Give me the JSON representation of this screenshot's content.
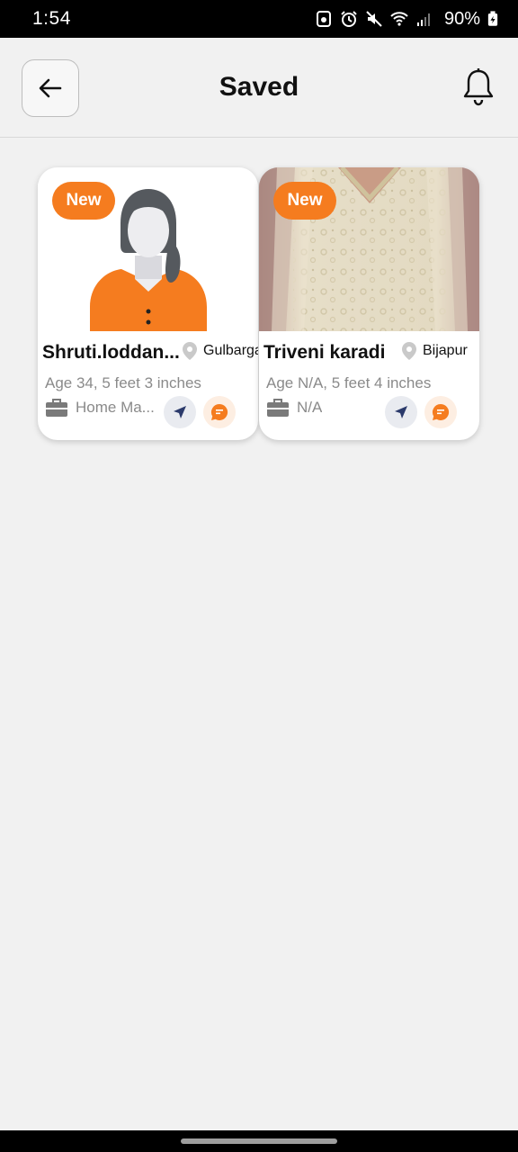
{
  "status_bar": {
    "time": "1:54",
    "battery": "90%",
    "icons": [
      "app-notification-icon",
      "alarm-icon",
      "mute-icon",
      "wifi-icon",
      "signal-icon",
      "battery-charging-icon"
    ]
  },
  "header": {
    "title": "Saved",
    "back_icon": "arrow-left-icon",
    "notification_icon": "bell-icon"
  },
  "profiles": [
    {
      "badge": "New",
      "name": "Shruti.loddan...",
      "location": "Gulbarga",
      "age_height": "Age 34, 5 feet 3 inches",
      "occupation": "Home Ma...",
      "photo": "placeholder-avatar-female"
    },
    {
      "badge": "New",
      "name": "Triveni karadi",
      "location": "Bijapur",
      "age_height": "Age N/A, 5 feet 4 inches",
      "occupation": "N/A",
      "photo": "photo-cream-embroidered-dress"
    }
  ],
  "colors": {
    "accent": "#f57c1f",
    "background": "#f1f1f1",
    "card": "#ffffff",
    "muted_text": "#8a8a8a"
  }
}
